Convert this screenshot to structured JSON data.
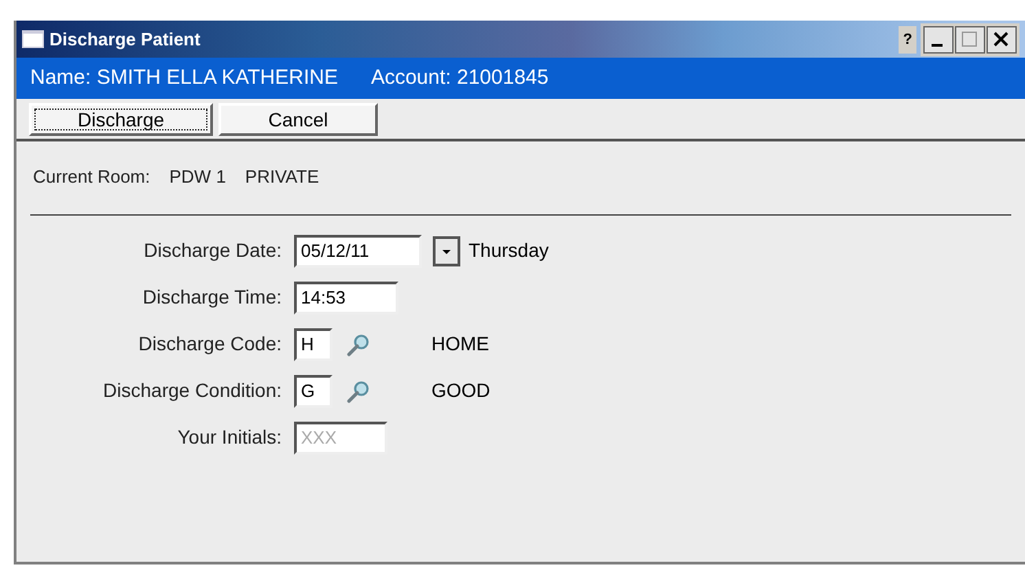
{
  "window": {
    "title": "Discharge Patient",
    "help": "?"
  },
  "header": {
    "name": "Name: SMITH ELLA KATHERINE",
    "account": "Account: 21001845"
  },
  "buttons": [
    {
      "label": "Discharge",
      "focused": true
    },
    {
      "label": "Cancel",
      "focused": false
    }
  ],
  "room": {
    "label": "Current Room:",
    "number": "PDW 1",
    "type": "PRIVATE"
  },
  "fields": [
    {
      "kind": "date",
      "label": "Discharge Date:",
      "value": "05/12/11",
      "note": "Thursday"
    },
    {
      "kind": "text",
      "label": "Discharge Time:",
      "value": "14:53"
    },
    {
      "kind": "lookup",
      "label": "Discharge Code:",
      "value": "H",
      "note": "HOME"
    },
    {
      "kind": "lookup",
      "label": "Discharge Condition:",
      "value": "G",
      "note": "GOOD"
    },
    {
      "kind": "disabled",
      "label": "Your Initials:",
      "placeholder": "XXX"
    }
  ]
}
